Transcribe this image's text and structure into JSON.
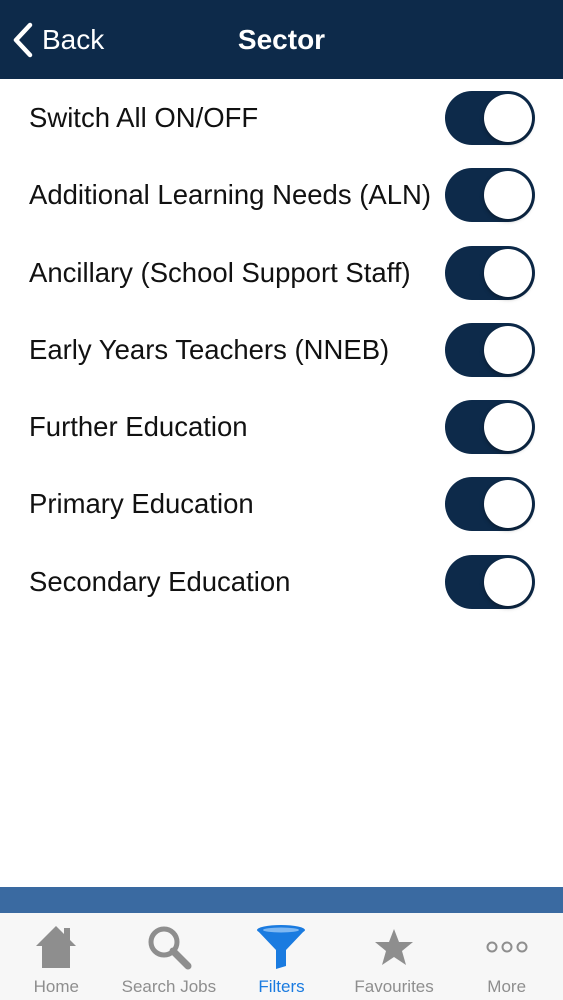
{
  "navbar": {
    "back_label": "Back",
    "title": "Sector",
    "background": "#0d2a4a"
  },
  "settings": [
    {
      "label": "Switch All ON/OFF",
      "on": true
    },
    {
      "label": "Additional Learning Needs (ALN)",
      "on": true
    },
    {
      "label": "Ancillary (School Support Staff)",
      "on": true
    },
    {
      "label": "Early Years Teachers (NNEB)",
      "on": true
    },
    {
      "label": "Further Education",
      "on": true
    },
    {
      "label": "Primary Education",
      "on": true
    },
    {
      "label": "Secondary Education",
      "on": true
    }
  ],
  "tabbar": {
    "accent": "#1a7be0",
    "inactive_color": "#8e8e8e",
    "items": [
      {
        "label": "Home",
        "icon": "home-icon",
        "active": false
      },
      {
        "label": "Search Jobs",
        "icon": "search-icon",
        "active": false
      },
      {
        "label": "Filters",
        "icon": "filter-icon",
        "active": true
      },
      {
        "label": "Favourites",
        "icon": "star-icon",
        "active": false
      },
      {
        "label": "More",
        "icon": "more-icon",
        "active": false
      }
    ]
  }
}
